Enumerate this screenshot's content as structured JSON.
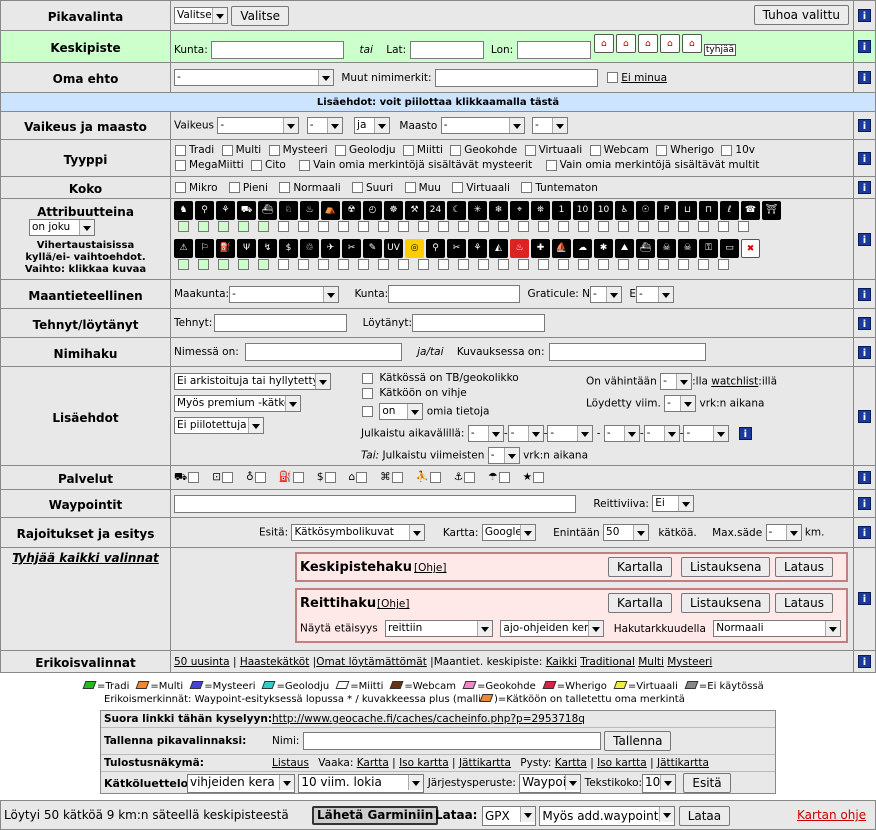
{
  "pikavalinta": {
    "label": "Pikavalinta",
    "select": "Valitse",
    "choose_btn": "Valitse",
    "clear_btn": "Tuhoa valittu"
  },
  "keskipiste": {
    "label": "Keskipiste",
    "kunta_label": "Kunta:",
    "tai": "tai",
    "lat_label": "Lat:",
    "lon_label": "Lon:",
    "empty_btn": "tyhjää"
  },
  "oma_ehto": {
    "label": "Oma ehto",
    "select": "-",
    "other_label": "Muut nimimerkit:",
    "not_me": "Ei minua"
  },
  "lisaehdot_bar": "Lisäehdot: voit piilottaa klikkaamalla tästä",
  "vaikeus": {
    "label": "Vaikeus ja maasto",
    "vaikeus_label": "Vaikeus",
    "sel1": "-",
    "sel2": "-",
    "and": "ja",
    "maasto_label": "Maasto",
    "sel3": "-",
    "sel4": "-"
  },
  "tyyppi": {
    "label": "Tyyppi",
    "items": [
      "Tradi",
      "Multi",
      "Mysteeri",
      "Geolodju",
      "Miitti",
      "Geokohde",
      "Virtuaali",
      "Webcam",
      "Wherigo",
      "10v"
    ],
    "items2": [
      "MegaMiitti",
      "Cito",
      "Vain omia merkintöjä sisältävät mysteerit",
      "Vain omia merkintöjä sisältävät multit"
    ]
  },
  "koko": {
    "label": "Koko",
    "items": [
      "Mikro",
      "Pieni",
      "Normaali",
      "Suuri",
      "Muu",
      "Virtuaali",
      "Tuntematon"
    ]
  },
  "attribuutteina": {
    "label": "Attribuutteina",
    "select": "on joku",
    "note1": "Vihertaustaisissa",
    "note2": "kyllä/ei- vaihtoehdot.",
    "note3": "Vaihto: klikkaa kuvaa"
  },
  "maantieteellinen": {
    "label": "Maantieteellinen",
    "maakunta_label": "Maakunta:",
    "maakunta": "-",
    "kunta_label": "Kunta:",
    "graticule_label": "Graticule: N",
    "n": "-",
    "e_label": "E",
    "e": "-"
  },
  "tehnyt": {
    "label": "Tehnyt/löytänyt",
    "tehnyt_label": "Tehnyt:",
    "loytanyt_label": "Löytänyt:"
  },
  "nimihaku": {
    "label": "Nimihaku",
    "nimessa_label": "Nimessä on:",
    "jatai": "ja/tai",
    "kuvauksessa_label": "Kuvauksessa on:"
  },
  "lisaehdot": {
    "label": "Lisäehdot",
    "sel1": "Ei arkistoituja tai hyllytettyjä",
    "sel2": "Myös premium -kätköt",
    "sel3": "Ei piilotettuja",
    "tb": "Kätkössä on TB/geokolikko",
    "vihje": "Kätköön on vihje",
    "on": "on",
    "omia": "omia tietoja",
    "watch_prefix": "On vähintään",
    "watch_sel": "-",
    "watch_mid": ":lla",
    "watch_link": "watchlist",
    "watch_suffix": ":illä",
    "found_label": "Löydetty viim.",
    "found_sel": "-",
    "found_suffix": "vrk:n aikana",
    "julk_label": "Julkaistu aikavälillä:",
    "tai_label": "Tai:",
    "viim_label": "Julkaistu viimeisten",
    "viim_sel": "-",
    "viim_suffix": "vrk:n aikana"
  },
  "palvelut": {
    "label": "Palvelut"
  },
  "waypointit": {
    "label": "Waypointit",
    "reittiviiva_label": "Reittiviiva:",
    "reittiviiva": "Ei"
  },
  "rajoitukset": {
    "label": "Rajoitukset ja esitys",
    "esita_label": "Esitä:",
    "esita": "Kätkösymbolikuvat",
    "kartta_label": "Kartta:",
    "kartta": "Google",
    "enintaan_label": "Enintään",
    "enintaan": "50",
    "katkoa": "kätköä.",
    "maxsade_label": "Max.säde",
    "maxsade": "-",
    "km": "km."
  },
  "tyhjaa": "Tyhjää kaikki valinnat",
  "keskipistehaku": {
    "title": "Keskipistehaku",
    "ohje": "[Ohje]",
    "kartalla": "Kartalla",
    "listauksena": "Listauksena",
    "lataus": "Lataus"
  },
  "reittihaku": {
    "title": "Reittihaku",
    "ohje": "[Ohje]",
    "kartalla": "Kartalla",
    "listauksena": "Listauksena",
    "lataus": "Lataus",
    "etaisyys_label": "Näytä etäisyys",
    "etaisyys": "reittiin",
    "ajo": "ajo-ohjeiden kera",
    "tarkkuus_label": "Hakutarkkuudella",
    "tarkkuus": "Normaali"
  },
  "erikoisvalinnat": {
    "label": "Erikoisvalinnat",
    "links": [
      "50 uusinta",
      "Haastekätköt",
      "Omat löytämättömät"
    ],
    "maant_label": "Maantiet. keskipiste:",
    "maant_links": [
      "Kaikki",
      "Traditional",
      "Multi",
      "Mysteeri"
    ]
  },
  "legend": {
    "items": [
      {
        "t": "=Tradi",
        "c": "#22bb22"
      },
      {
        "t": "=Multi",
        "c": "#ee8833"
      },
      {
        "t": "=Mysteeri",
        "c": "#4444dd"
      },
      {
        "t": "=Geolodju",
        "c": "#33cccc"
      },
      {
        "t": "=Miitti",
        "c": "#ffffff"
      },
      {
        "t": "=Webcam",
        "c": "#663311"
      },
      {
        "t": "=Geokohde",
        "c": "#ee88cc"
      },
      {
        "t": "=Wherigo",
        "c": "#dd2244"
      },
      {
        "t": "=Virtuaali",
        "c": "#eeee44"
      },
      {
        "t": "=Ei käytössä",
        "c": "#888888"
      }
    ],
    "note": "Erikoismerkinnät: Waypoint-esityksessä lopussa * / kuvakkeessa plus (malli",
    "note2": ")=Kätköön on talletettu oma merkintä"
  },
  "suora": {
    "label": "Suora linkki tähän kyselyyn:",
    "url": "http://www.geocache.fi/caches/cacheinfo.php?p=2953718q"
  },
  "tallenna": {
    "label": "Tallenna pikavalinnaksi:",
    "nimi_label": "Nimi:",
    "btn": "Tallenna"
  },
  "tulostus": {
    "label": "Tulostusnäkymä:",
    "listaus": "Listaus",
    "vaaka_label": "Vaaka:",
    "kartta": "Kartta",
    "iso": "Iso kartta",
    "jatti": "Jättikartta",
    "pysty_label": "Pysty:"
  },
  "katkoluettelo": {
    "label": "Kätköluettelo:",
    "sel1": "vihjeiden kera",
    "sel2": "10 viim. lokia",
    "jarj_label": "Järjestysperuste:",
    "jarj": "Waypoint",
    "teksti_label": "Tekstikoko:",
    "teksti": "10",
    "btn": "Esitä"
  },
  "status": {
    "text": "Löytyi 50 kätköä 9 km:n säteellä keskipisteestä",
    "garmin_btn": "Lähetä Garminiin",
    "lataa_label": "Lataa:",
    "format": "GPX",
    "addwp": "Myös add.waypointit",
    "lataa_btn": "Lataa",
    "help": "Kartan ohje"
  }
}
